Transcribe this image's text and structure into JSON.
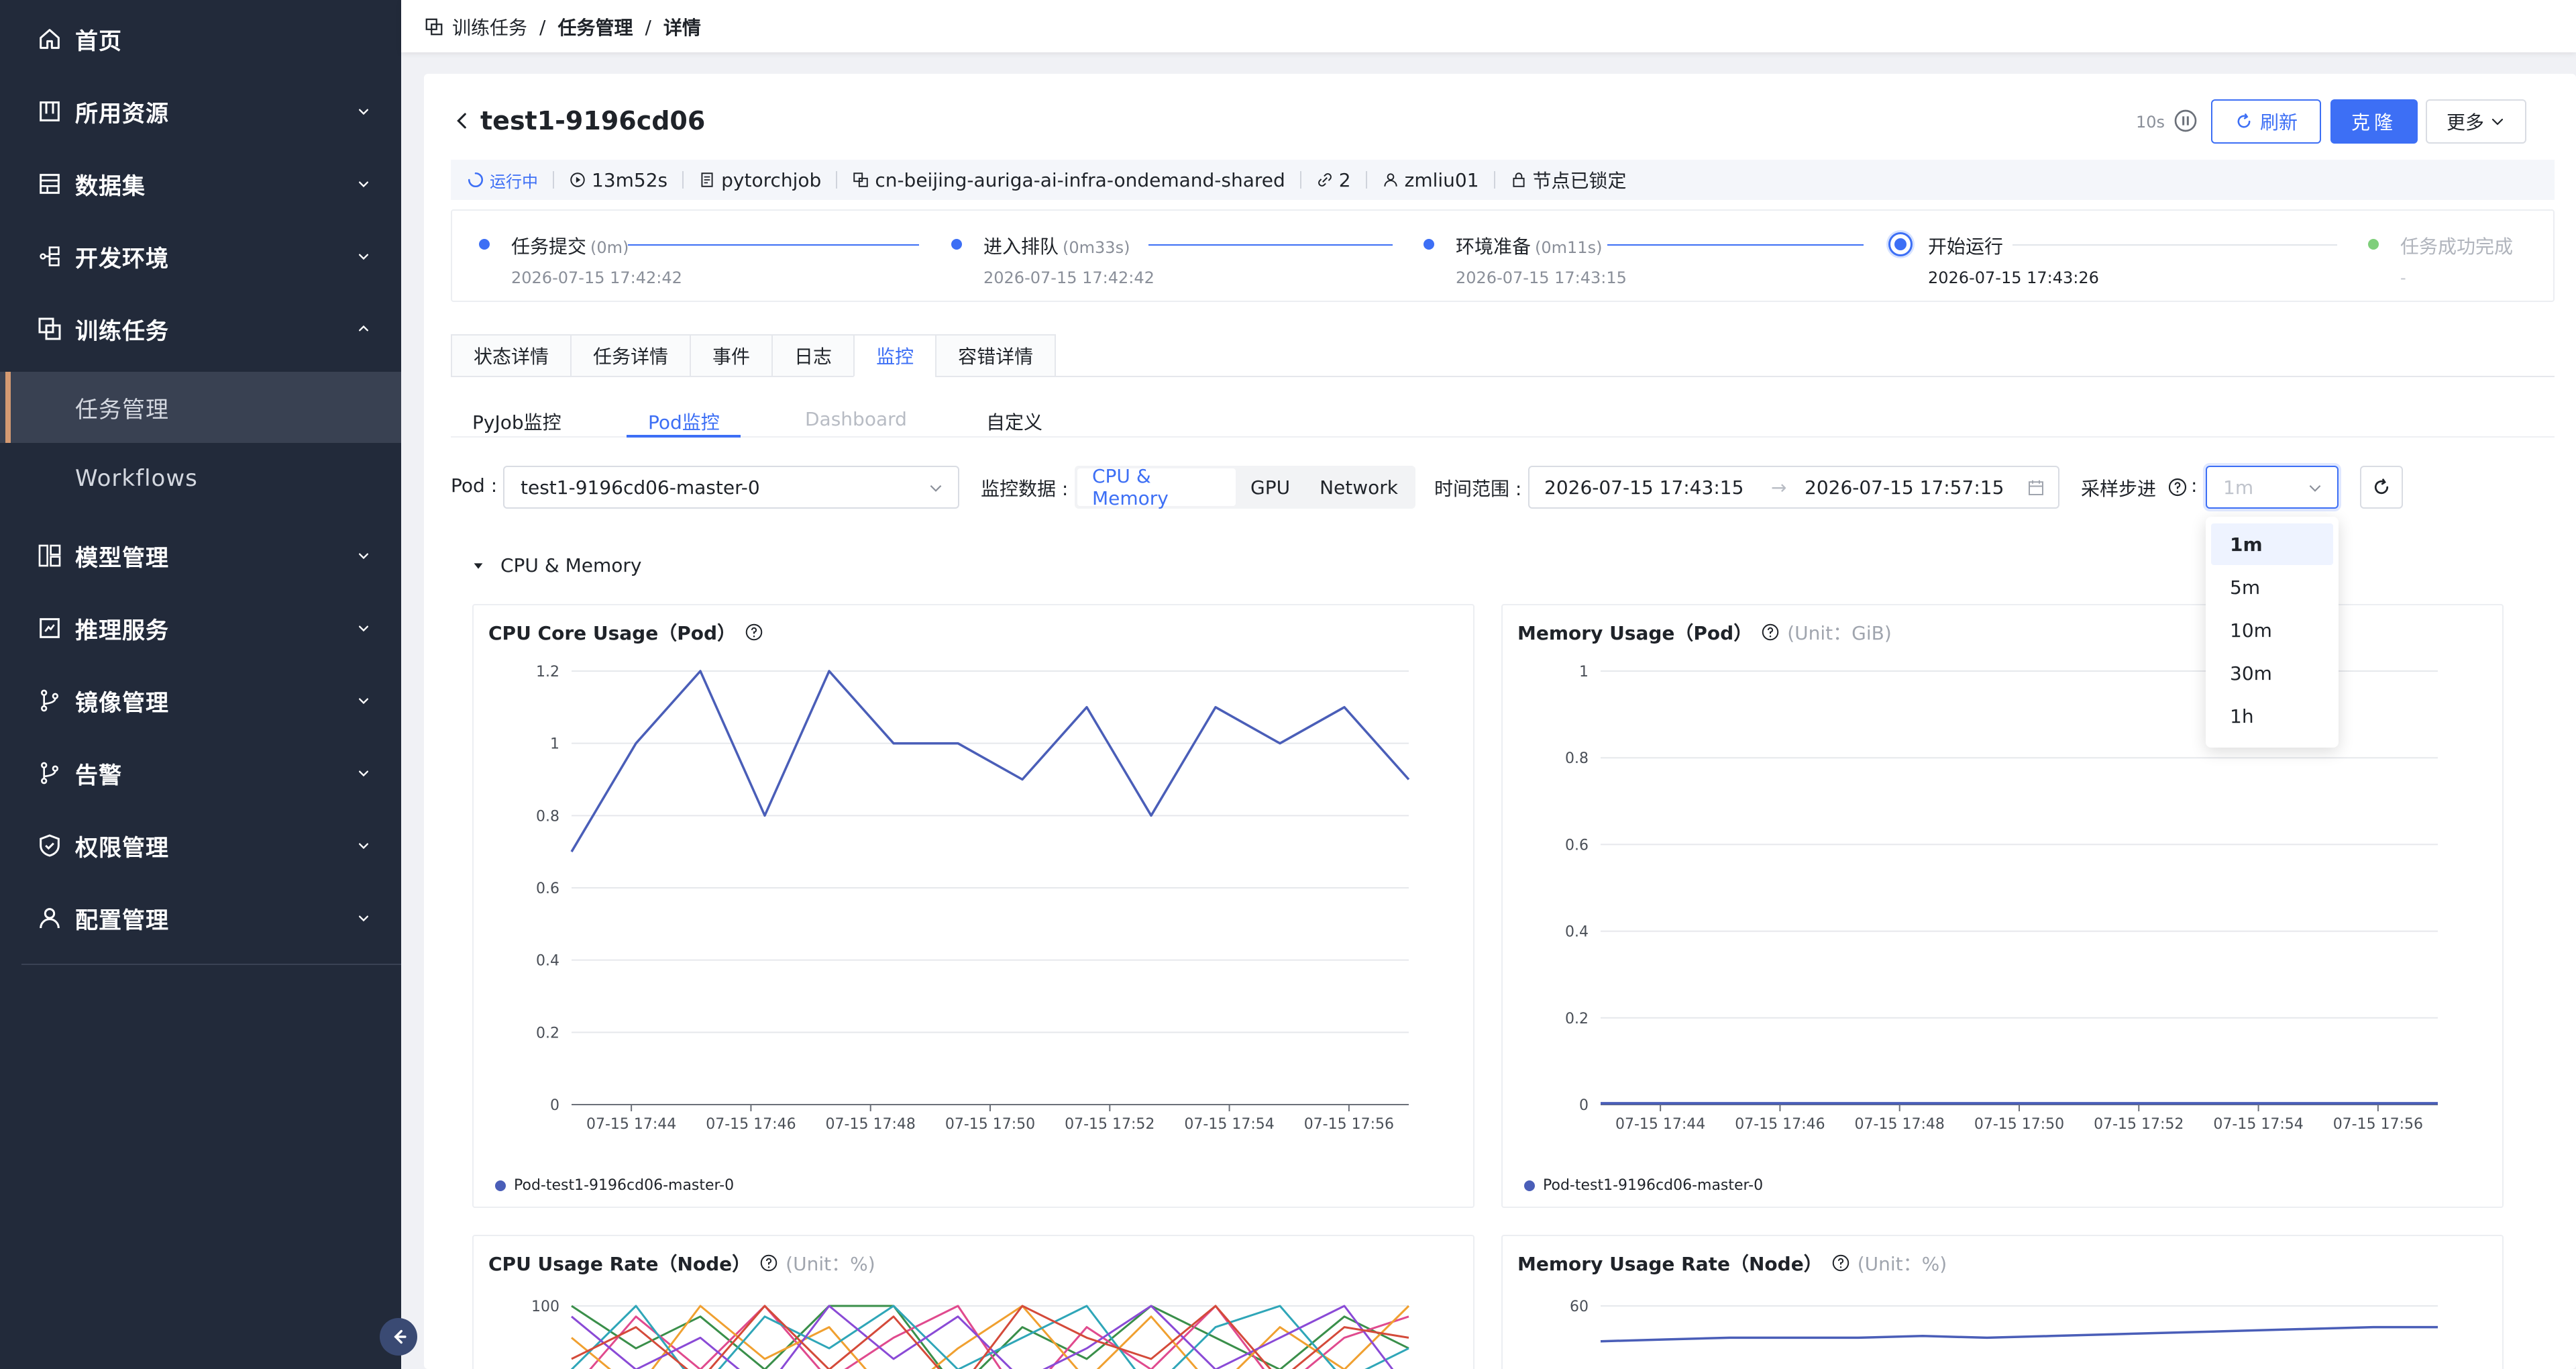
{
  "sidebar": {
    "items": [
      {
        "label": "首页",
        "icon": "home-icon",
        "chevron": false
      },
      {
        "label": "所用资源",
        "icon": "resource-icon",
        "chevron": "down"
      },
      {
        "label": "数据集",
        "icon": "dataset-icon",
        "chevron": "down"
      },
      {
        "label": "开发环境",
        "icon": "dev-env-icon",
        "chevron": "down"
      },
      {
        "label": "训练任务",
        "icon": "training-icon",
        "chevron": "up"
      },
      {
        "label": "模型管理",
        "icon": "model-icon",
        "chevron": "down"
      },
      {
        "label": "推理服务",
        "icon": "inference-icon",
        "chevron": "down"
      },
      {
        "label": "镜像管理",
        "icon": "image-branch-icon",
        "chevron": "down"
      },
      {
        "label": "告警",
        "icon": "alert-branch-icon",
        "chevron": "down"
      },
      {
        "label": "权限管理",
        "icon": "shield-icon",
        "chevron": "down"
      },
      {
        "label": "配置管理",
        "icon": "user-config-icon",
        "chevron": "down"
      }
    ],
    "sub_items": [
      {
        "label": "任务管理",
        "active": true
      },
      {
        "label": "Workflows",
        "active": false
      }
    ]
  },
  "breadcrumb": {
    "items": [
      "训练任务",
      "任务管理",
      "详情"
    ]
  },
  "header": {
    "title": "test1-9196cd06",
    "refresh_interval": "10s",
    "refresh_label": "刷新",
    "clone_label": "克隆",
    "more_label": "更多"
  },
  "info": {
    "status": "运行中",
    "duration": "13m52s",
    "job_type": "pytorchjob",
    "cluster": "cn-beijing-auriga-ai-infra-ondemand-shared",
    "replicas": "2",
    "user": "zmliu01",
    "lock": "节点已锁定"
  },
  "steps": [
    {
      "title": "任务提交",
      "duration": "(0m)",
      "time": "2026-07-15 17:42:42",
      "state": "done"
    },
    {
      "title": "进入排队",
      "duration": "(0m33s)",
      "time": "2026-07-15 17:42:42",
      "state": "done"
    },
    {
      "title": "环境准备",
      "duration": "(0m11s)",
      "time": "2026-07-15 17:43:15",
      "state": "done"
    },
    {
      "title": "开始运行",
      "duration": "",
      "time": "2026-07-15 17:43:26",
      "state": "current"
    },
    {
      "title": "任务成功完成",
      "duration": "",
      "time": "-",
      "state": "pending"
    }
  ],
  "tabs": [
    "状态详情",
    "任务详情",
    "事件",
    "日志",
    "监控",
    "容错详情"
  ],
  "active_tab": "监控",
  "subtabs": [
    {
      "label": "PyJob监控",
      "state": "normal"
    },
    {
      "label": "Pod监控",
      "state": "active"
    },
    {
      "label": "Dashboard",
      "state": "disabled"
    },
    {
      "label": "自定义",
      "state": "normal"
    }
  ],
  "filters": {
    "pod_label": "Pod :",
    "pod_value": "test1-9196cd06-master-0",
    "metric_label": "监控数据 :",
    "metric_options": [
      "CPU & Memory",
      "GPU",
      "Network"
    ],
    "metric_selected": "CPU & Memory",
    "range_label": "时间范围 :",
    "range_start": "2026-07-15 17:43:15",
    "range_arrow": "→",
    "range_end": "2026-07-15 17:57:15",
    "step_label": "采样步进",
    "step_colon": ":",
    "step_placeholder": "1m",
    "step_options": [
      "1m",
      "5m",
      "10m",
      "30m",
      "1h"
    ],
    "step_selected": "1m"
  },
  "section": {
    "title": "CPU & Memory"
  },
  "x_tick_labels": [
    "07-15 17:44",
    "07-15 17:46",
    "07-15 17:48",
    "07-15 17:50",
    "07-15 17:52",
    "07-15 17:54",
    "07-15 17:56"
  ],
  "chart_data": [
    {
      "type": "line",
      "title": "CPU Core Usage（Pod）",
      "unit": "",
      "x": [
        "17:43",
        "17:44",
        "17:45",
        "17:46",
        "17:47",
        "17:48",
        "17:49",
        "17:50",
        "17:51",
        "17:52",
        "17:53",
        "17:54",
        "17:55",
        "17:56",
        "17:57"
      ],
      "series": [
        {
          "name": "Pod-test1-9196cd06-master-0",
          "color": "#4a5eb8",
          "values": [
            0.7,
            1.0,
            1.2,
            0.8,
            1.2,
            1.0,
            1.0,
            0.9,
            1.1,
            0.8,
            1.1,
            1.0,
            1.1,
            0.9
          ]
        }
      ],
      "yticks": [
        "0",
        "0.2",
        "0.4",
        "0.6",
        "0.8",
        "1",
        "1.2"
      ],
      "ylim": [
        0,
        1.2
      ]
    },
    {
      "type": "line",
      "title": "Memory Usage（Pod）",
      "unit": "(Unit：GiB)",
      "series": [
        {
          "name": "Pod-test1-9196cd06-master-0",
          "color": "#4a5eb8",
          "values": [
            0.003,
            0.003,
            0.003,
            0.003,
            0.003,
            0.003,
            0.003,
            0.003,
            0.003,
            0.003,
            0.003,
            0.003,
            0.003,
            0.003
          ]
        }
      ],
      "yticks": [
        "0",
        "0.2",
        "0.4",
        "0.6",
        "0.8",
        "1"
      ],
      "ylim": [
        0,
        1
      ]
    },
    {
      "type": "line",
      "title": "CPU Usage Rate（Node）",
      "unit": "(Unit：%)",
      "yticks": [
        "100"
      ],
      "series": [
        {
          "color": "#3a8f4a",
          "values": [
            100,
            80,
            95,
            70,
            100,
            100,
            60,
            90,
            75,
            100,
            85,
            70,
            95,
            80
          ]
        },
        {
          "color": "#e04a8e",
          "values": [
            60,
            95,
            70,
            100,
            65,
            85,
            100,
            55,
            90,
            70,
            100,
            60,
            85,
            95
          ]
        },
        {
          "color": "#f0a030",
          "values": [
            85,
            60,
            100,
            75,
            90,
            55,
            80,
            100,
            65,
            95,
            60,
            90,
            70,
            100
          ]
        },
        {
          "color": "#2fa6b8",
          "values": [
            70,
            100,
            60,
            95,
            80,
            100,
            70,
            85,
            100,
            60,
            90,
            100,
            65,
            80
          ]
        },
        {
          "color": "#8a4ad6",
          "values": [
            95,
            70,
            85,
            60,
            100,
            75,
            95,
            65,
            80,
            100,
            70,
            85,
            100,
            60
          ]
        },
        {
          "color": "#d44a3a",
          "values": [
            75,
            90,
            65,
            100,
            70,
            95,
            60,
            100,
            85,
            75,
            100,
            65,
            90,
            85
          ]
        }
      ]
    },
    {
      "type": "line",
      "title": "Memory Usage Rate（Node）",
      "unit": "(Unit：%)",
      "yticks": [
        "60"
      ],
      "series": [
        {
          "color": "#4a5eb8",
          "values": [
            50,
            50.5,
            51,
            51,
            51,
            51.5,
            51,
            51.5,
            52,
            52.5,
            53,
            53.5,
            54,
            54
          ]
        }
      ]
    }
  ]
}
